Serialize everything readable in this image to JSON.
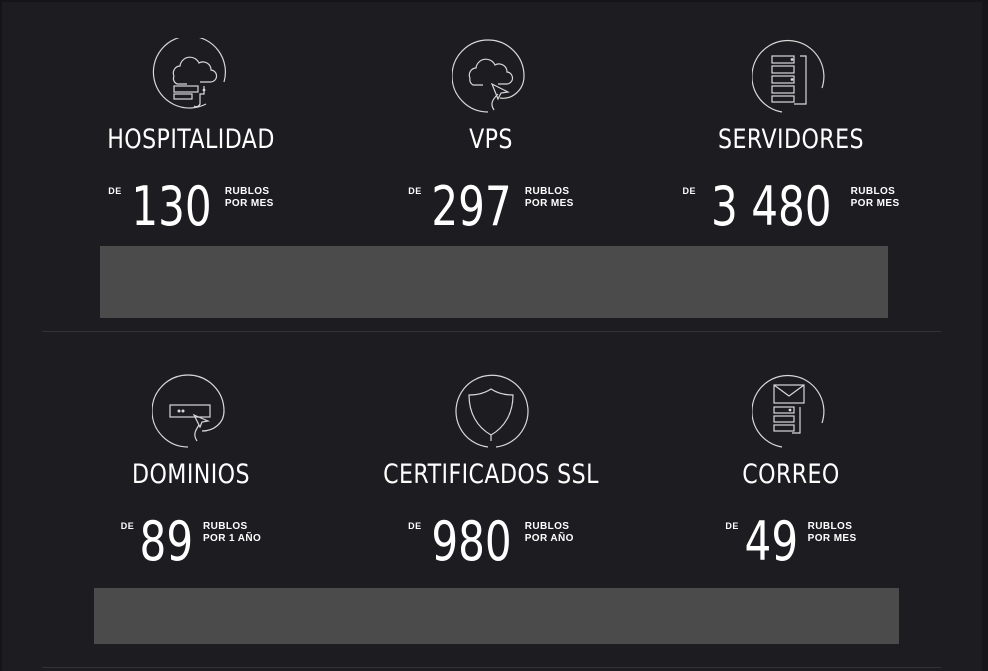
{
  "products": [
    {
      "id": "hosting",
      "title": "HOSPITALIDAD",
      "prefix": "DE",
      "price": "130",
      "unit_line1": "RUBLOS",
      "unit_line2": "POR MES",
      "icon": "cloud-server-icon"
    },
    {
      "id": "vps",
      "title": "VPS",
      "prefix": "DE",
      "price": "297",
      "unit_line1": "RUBLOS",
      "unit_line2": "POR MES",
      "icon": "cloud-cursor-icon"
    },
    {
      "id": "servers",
      "title": "SERVIDORES",
      "prefix": "DE",
      "price": "3 480",
      "unit_line1": "RUBLOS",
      "unit_line2": "POR MES",
      "icon": "server-rack-icon"
    },
    {
      "id": "domains",
      "title": "DOMINIOS",
      "prefix": "DE",
      "price": "89",
      "unit_line1": "RUBLOS",
      "unit_line2": "POR 1 AÑO",
      "icon": "domain-cursor-icon"
    },
    {
      "id": "ssl",
      "title": "CERTIFICADOS SSL",
      "prefix": "DE",
      "price": "980",
      "unit_line1": "RUBLOS",
      "unit_line2": "POR AÑO",
      "icon": "shield-icon"
    },
    {
      "id": "mail",
      "title": "CORREO",
      "prefix": "DE",
      "price": "49",
      "unit_line1": "RUBLOS",
      "unit_line2": "POR MES",
      "icon": "mail-server-icon"
    }
  ],
  "colors": {
    "background": "#1d1c20",
    "placeholder_bar": "#4b4b4b",
    "text": "#ffffff",
    "icon_stroke": "#d8d8d8"
  }
}
